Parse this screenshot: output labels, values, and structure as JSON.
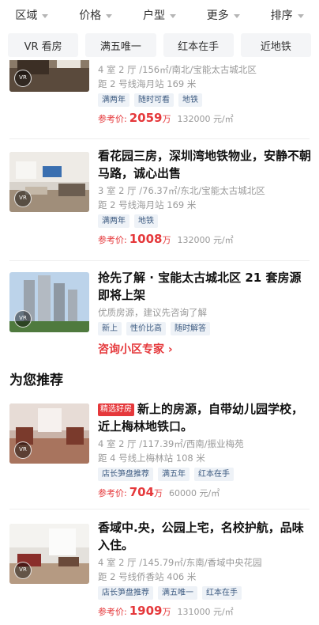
{
  "filters": [
    {
      "label": "区域"
    },
    {
      "label": "价格"
    },
    {
      "label": "户型"
    },
    {
      "label": "更多"
    },
    {
      "label": "排序"
    }
  ],
  "quick_chips": [
    {
      "label": "VR 看房"
    },
    {
      "label": "满五唯一"
    },
    {
      "label": "红本在手"
    },
    {
      "label": "近地铁"
    }
  ],
  "listings": [
    {
      "title": "",
      "specs": "4 室 2 厅 /156㎡/南北/宝能太古城北区",
      "metro": "距 2 号线海月站 169 米",
      "tags": [
        "满两年",
        "随时可看",
        "地铁"
      ],
      "price_label": "参考价:",
      "price": "2059",
      "price_unit": "万",
      "unit_price": "132000 元/㎡"
    },
    {
      "title": "看花园三房，深圳湾地铁物业，安静不朝马路，诚心出售",
      "specs": "3 室 2 厅 /76.37㎡/东北/宝能太古城北区",
      "metro": "距 2 号线海月站 169 米",
      "tags": [
        "满两年",
        "地铁"
      ],
      "price_label": "参考价:",
      "price": "1008",
      "price_unit": "万",
      "unit_price": "132000 元/㎡"
    }
  ],
  "community_promo": {
    "title": "抢先了解 · 宝能太古城北区 21 套房源即将上架",
    "subtitle": "优质房源，建议先咨询了解",
    "tags": [
      "新上",
      "性价比高",
      "随时解答"
    ],
    "link": "咨询小区专家 ›"
  },
  "recommend": {
    "heading": "为您推荐",
    "items": [
      {
        "flag": "精选好房",
        "title": "新上的房源，自带幼儿园学校，近上梅林地铁口。",
        "specs": "4 室 2 厅 /117.39㎡/西南/振业梅苑",
        "metro": "距 4 号线上梅林站 108 米",
        "tags": [
          "店长笋盘推荐",
          "满五年",
          "红本在手"
        ],
        "price_label": "参考价:",
        "price": "704",
        "price_unit": "万",
        "unit_price": "60000 元/㎡"
      },
      {
        "flag": "",
        "title": "香域中.央，公园上宅，名校护航，品味入住。",
        "specs": "4 室 2 厅 /145.79㎡/东南/香域中央花园",
        "metro": "距 2 号线侨香站 406 米",
        "tags": [
          "店长笋盘推荐",
          "满五唯一",
          "红本在手"
        ],
        "price_label": "参考价:",
        "price": "1909",
        "price_unit": "万",
        "unit_price": "131000 元/㎡"
      }
    ]
  },
  "vr_badge_label": "VR",
  "colors": {
    "accent": "#e5383b",
    "tag_bg": "#eef2f7",
    "tag_text": "#3c5a80",
    "muted": "#9a9a9a"
  }
}
